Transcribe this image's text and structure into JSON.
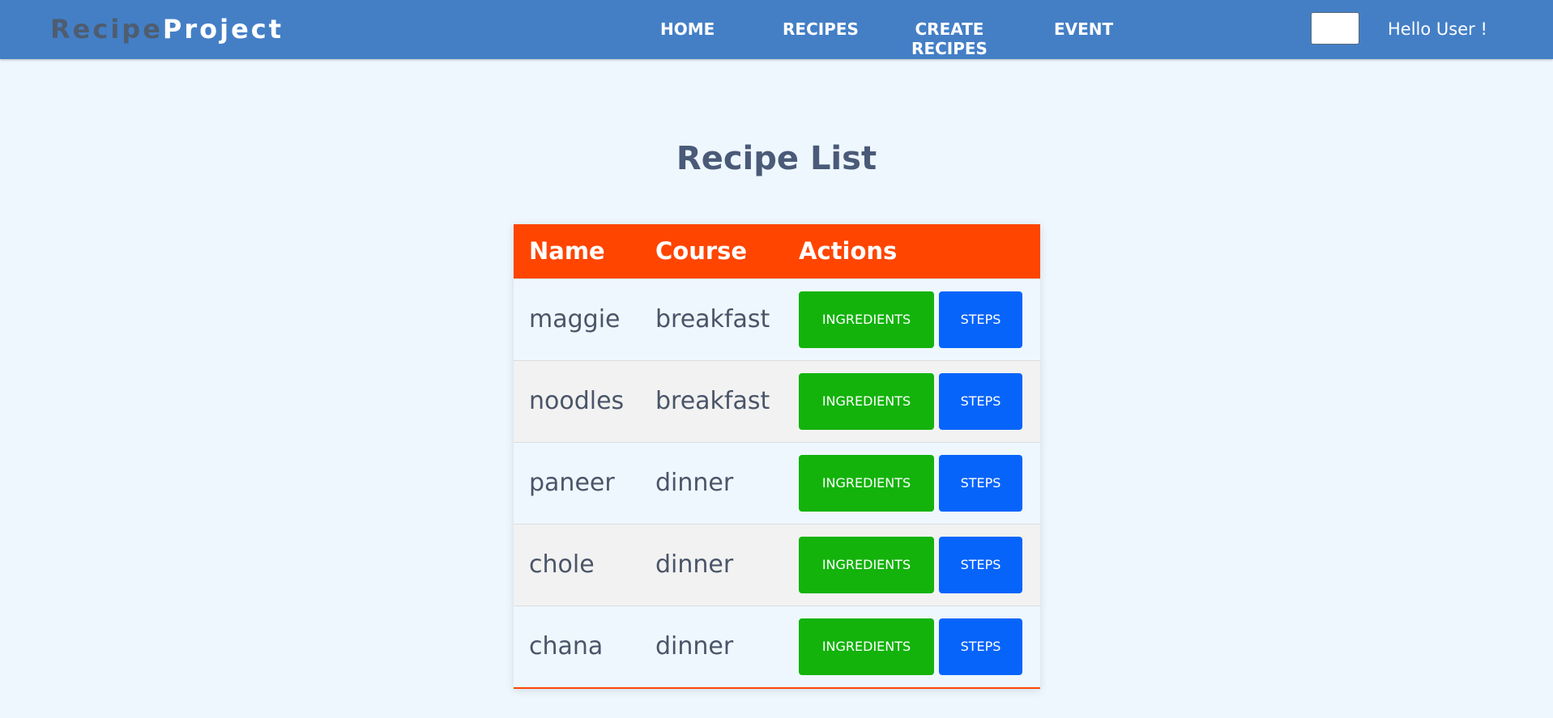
{
  "brand": {
    "part1": "Recipe",
    "part2": "Project"
  },
  "nav": {
    "home": "HOME",
    "recipes": "RECIPES",
    "create": "CREATE RECIPES",
    "event": "EVENT",
    "greeting": "Hello User !"
  },
  "page": {
    "title": "Recipe List"
  },
  "table": {
    "headers": [
      "Name",
      "Course",
      "Actions"
    ],
    "rows": [
      {
        "name": "maggie",
        "course": "breakfast",
        "ingredients": "INGREDIENTS",
        "steps": "STEPS"
      },
      {
        "name": "noodles",
        "course": "breakfast",
        "ingredients": "INGREDIENTS",
        "steps": "STEPS"
      },
      {
        "name": "paneer",
        "course": "dinner",
        "ingredients": "INGREDIENTS",
        "steps": "STEPS"
      },
      {
        "name": "chole",
        "course": "dinner",
        "ingredients": "INGREDIENTS",
        "steps": "STEPS"
      },
      {
        "name": "chana",
        "course": "dinner",
        "ingredients": "INGREDIENTS",
        "steps": "STEPS"
      }
    ]
  },
  "colors": {
    "navbar": "#447fc6",
    "header": "#ff4500",
    "ingredients_button": "#13b30b",
    "steps_button": "#0764fb",
    "background": "#eef7fe"
  }
}
